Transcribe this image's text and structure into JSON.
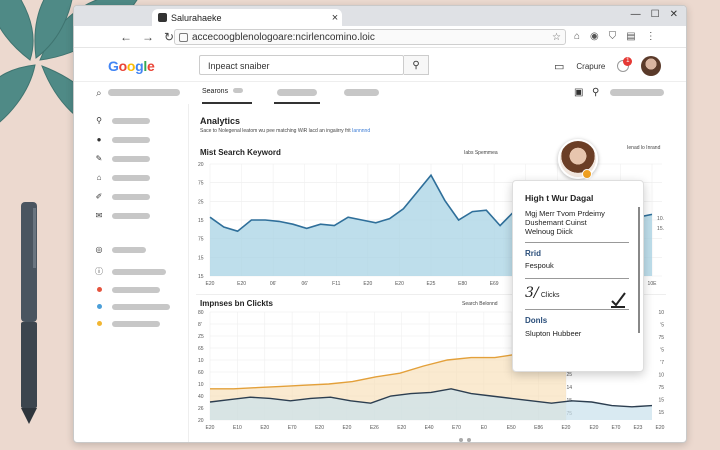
{
  "browser": {
    "tab_title": "Salurahaeke",
    "tab_close": "×",
    "url": "accecoogblenologoare:ncirlencomino.loic",
    "window_controls": [
      "—",
      "☐",
      "✕"
    ]
  },
  "app": {
    "logo": [
      "G",
      "o",
      "o",
      "g",
      "l",
      "e"
    ],
    "search_placeholder": "Inpeact snaiber",
    "right_label": "Crapure",
    "notification_count": "1"
  },
  "subnav": {
    "active_tab": "Searons"
  },
  "main": {
    "heading": "Analytics",
    "subtext": "Sace to Nolegenal leatom wu pee matching  WiR lacd an ingaiirry frit",
    "subtext_link": "Iannnnd",
    "chart1": {
      "title": "Mist Search Keyword",
      "subtitle": "Iabs Spemmea"
    },
    "chart2": {
      "title": "Impnses bn Clickts",
      "subtitle": "Search Belonnd"
    }
  },
  "popup": {
    "corner_label": "Ienad lo Inrand",
    "title": "High t Wur Dagal",
    "lines": [
      "Mgj Merr Tvom Prdeimy",
      "Dushemant Cuinst",
      "Welnoug Diick"
    ],
    "section1": "Rrid",
    "section1_text": "Fespouk",
    "metric_value": "3/",
    "metric_label": "Clicks",
    "section2": "Donls",
    "section2_text": "Slupton Hubbeer"
  },
  "colors": {
    "accent_blue": "#2f6f9a",
    "area_blue": "#a8d3e4",
    "orange": "#e3a03a"
  },
  "chart_data": [
    {
      "type": "area",
      "title": "Mist Search Keyword",
      "y_ticks": [
        "20",
        "75",
        "25",
        "15",
        "75",
        "15",
        "15"
      ],
      "x_ticks": [
        "E20",
        "E20",
        "06'",
        "06'",
        "F11",
        "E20",
        "E20",
        "E25",
        "E80",
        "E69",
        "E62",
        "E69",
        "20'",
        "B'0",
        "10E"
      ],
      "right_ticks": [
        "10.",
        "15."
      ],
      "values": [
        62,
        55,
        52,
        60,
        60,
        59,
        57,
        54,
        57,
        56,
        62,
        60,
        58,
        61,
        68,
        80,
        92,
        74,
        60,
        66,
        67,
        56,
        66,
        57,
        55,
        57,
        55,
        53,
        60,
        58,
        62,
        62,
        64
      ]
    },
    {
      "type": "line",
      "title": "Impnses bn Clickts",
      "y_ticks": [
        "80",
        "8'",
        "Z5",
        "65",
        "10",
        "60",
        "10",
        "40",
        "26",
        "20"
      ],
      "x_ticks": [
        "E20",
        "E10",
        "E20",
        "E70",
        "E20",
        "E20",
        "E26",
        "E20",
        "E40",
        "E70",
        "E0",
        "E50",
        "E86",
        "E20"
      ],
      "right_ticks": [
        "75",
        "70",
        "'75",
        "14",
        "25",
        "14",
        "15",
        "75"
      ],
      "far_right_ticks": [
        "10",
        "'5",
        "75",
        "'5",
        "'7",
        "10",
        "75",
        "15",
        "15"
      ],
      "x_ticks_right": [
        "E20",
        "E70",
        "E23",
        "E20"
      ],
      "series": [
        {
          "values": [
            36,
            36,
            37,
            38,
            39,
            40,
            42,
            46,
            49,
            55,
            60,
            62,
            62,
            65,
            75,
            75
          ]
        },
        {
          "values": [
            25,
            27,
            29,
            28,
            26,
            28,
            29,
            26,
            24,
            30,
            32,
            33,
            36,
            32,
            30,
            28,
            26,
            24,
            26,
            25,
            22,
            21,
            22
          ]
        }
      ]
    }
  ]
}
